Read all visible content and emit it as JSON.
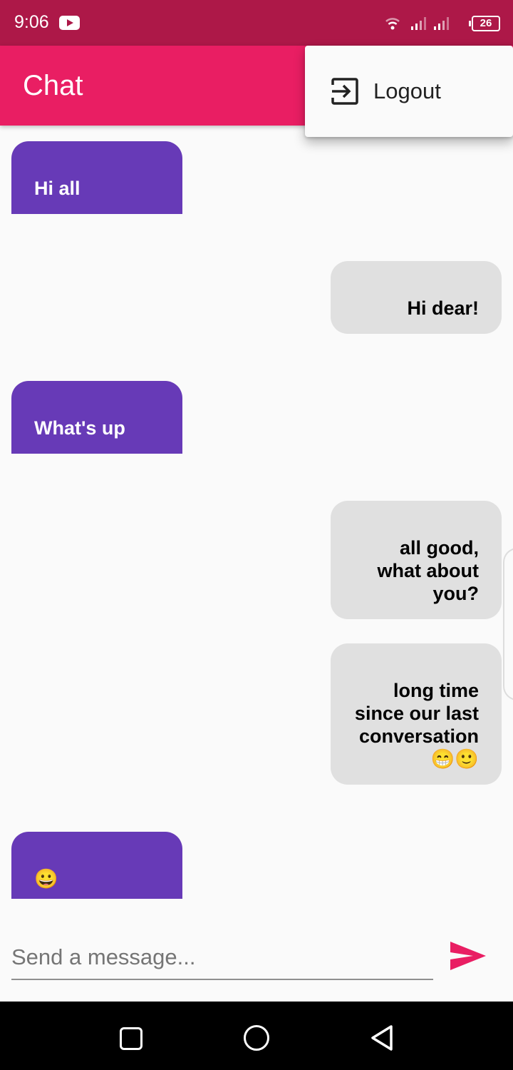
{
  "status_bar": {
    "time": "9:06",
    "battery": "26",
    "icons": [
      "youtube-icon",
      "wifi-icon",
      "signal-icon",
      "signal-icon",
      "battery-icon"
    ]
  },
  "app_bar": {
    "title": "Chat"
  },
  "menu": {
    "logout_label": "Logout",
    "icon": "logout-icon"
  },
  "messages": [
    {
      "sender": "received",
      "text": "Hi all"
    },
    {
      "sender": "sent",
      "text": "Hi dear!"
    },
    {
      "sender": "received",
      "text": "What's up"
    },
    {
      "sender": "sent",
      "text": "all good, what about you?"
    },
    {
      "sender": "sent",
      "text": "long time since our last conversation 😁🙂"
    },
    {
      "sender": "received",
      "text": "😀"
    }
  ],
  "composer": {
    "placeholder": "Send a message...",
    "send_icon": "send-icon"
  },
  "colors": {
    "status_bar": "#ad1848",
    "app_bar": "#e91e63",
    "received_bubble": "#673ab7",
    "sent_bubble": "#e0e0e0",
    "send_icon": "#e91e63"
  },
  "nav_bar": {
    "icons": [
      "recents-icon",
      "home-icon",
      "back-icon"
    ]
  }
}
